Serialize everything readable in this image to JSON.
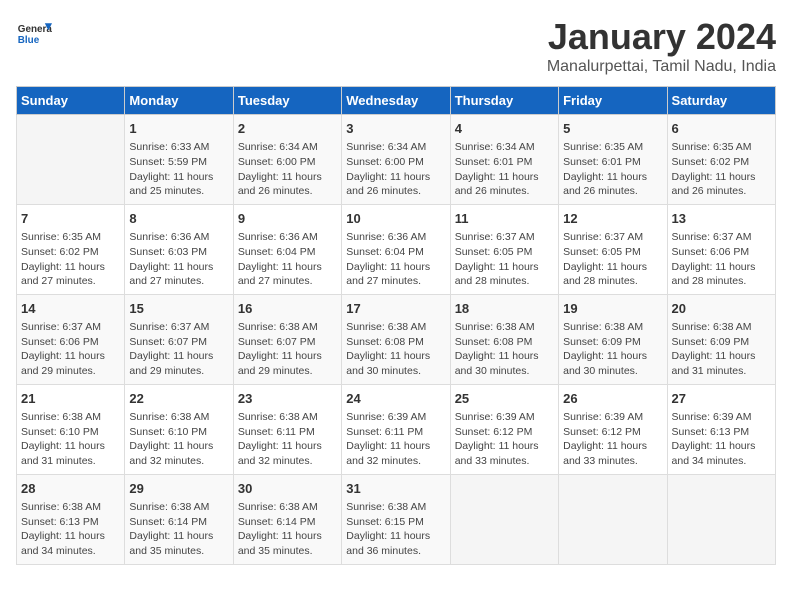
{
  "header": {
    "logo_general": "General",
    "logo_blue": "Blue",
    "title": "January 2024",
    "subtitle": "Manalurpettai, Tamil Nadu, India"
  },
  "calendar": {
    "days_of_week": [
      "Sunday",
      "Monday",
      "Tuesday",
      "Wednesday",
      "Thursday",
      "Friday",
      "Saturday"
    ],
    "weeks": [
      [
        {
          "day": "",
          "content": ""
        },
        {
          "day": "1",
          "content": "Sunrise: 6:33 AM\nSunset: 5:59 PM\nDaylight: 11 hours\nand 25 minutes."
        },
        {
          "day": "2",
          "content": "Sunrise: 6:34 AM\nSunset: 6:00 PM\nDaylight: 11 hours\nand 26 minutes."
        },
        {
          "day": "3",
          "content": "Sunrise: 6:34 AM\nSunset: 6:00 PM\nDaylight: 11 hours\nand 26 minutes."
        },
        {
          "day": "4",
          "content": "Sunrise: 6:34 AM\nSunset: 6:01 PM\nDaylight: 11 hours\nand 26 minutes."
        },
        {
          "day": "5",
          "content": "Sunrise: 6:35 AM\nSunset: 6:01 PM\nDaylight: 11 hours\nand 26 minutes."
        },
        {
          "day": "6",
          "content": "Sunrise: 6:35 AM\nSunset: 6:02 PM\nDaylight: 11 hours\nand 26 minutes."
        }
      ],
      [
        {
          "day": "7",
          "content": "Sunrise: 6:35 AM\nSunset: 6:02 PM\nDaylight: 11 hours\nand 27 minutes."
        },
        {
          "day": "8",
          "content": "Sunrise: 6:36 AM\nSunset: 6:03 PM\nDaylight: 11 hours\nand 27 minutes."
        },
        {
          "day": "9",
          "content": "Sunrise: 6:36 AM\nSunset: 6:04 PM\nDaylight: 11 hours\nand 27 minutes."
        },
        {
          "day": "10",
          "content": "Sunrise: 6:36 AM\nSunset: 6:04 PM\nDaylight: 11 hours\nand 27 minutes."
        },
        {
          "day": "11",
          "content": "Sunrise: 6:37 AM\nSunset: 6:05 PM\nDaylight: 11 hours\nand 28 minutes."
        },
        {
          "day": "12",
          "content": "Sunrise: 6:37 AM\nSunset: 6:05 PM\nDaylight: 11 hours\nand 28 minutes."
        },
        {
          "day": "13",
          "content": "Sunrise: 6:37 AM\nSunset: 6:06 PM\nDaylight: 11 hours\nand 28 minutes."
        }
      ],
      [
        {
          "day": "14",
          "content": "Sunrise: 6:37 AM\nSunset: 6:06 PM\nDaylight: 11 hours\nand 29 minutes."
        },
        {
          "day": "15",
          "content": "Sunrise: 6:37 AM\nSunset: 6:07 PM\nDaylight: 11 hours\nand 29 minutes."
        },
        {
          "day": "16",
          "content": "Sunrise: 6:38 AM\nSunset: 6:07 PM\nDaylight: 11 hours\nand 29 minutes."
        },
        {
          "day": "17",
          "content": "Sunrise: 6:38 AM\nSunset: 6:08 PM\nDaylight: 11 hours\nand 30 minutes."
        },
        {
          "day": "18",
          "content": "Sunrise: 6:38 AM\nSunset: 6:08 PM\nDaylight: 11 hours\nand 30 minutes."
        },
        {
          "day": "19",
          "content": "Sunrise: 6:38 AM\nSunset: 6:09 PM\nDaylight: 11 hours\nand 30 minutes."
        },
        {
          "day": "20",
          "content": "Sunrise: 6:38 AM\nSunset: 6:09 PM\nDaylight: 11 hours\nand 31 minutes."
        }
      ],
      [
        {
          "day": "21",
          "content": "Sunrise: 6:38 AM\nSunset: 6:10 PM\nDaylight: 11 hours\nand 31 minutes."
        },
        {
          "day": "22",
          "content": "Sunrise: 6:38 AM\nSunset: 6:10 PM\nDaylight: 11 hours\nand 32 minutes."
        },
        {
          "day": "23",
          "content": "Sunrise: 6:38 AM\nSunset: 6:11 PM\nDaylight: 11 hours\nand 32 minutes."
        },
        {
          "day": "24",
          "content": "Sunrise: 6:39 AM\nSunset: 6:11 PM\nDaylight: 11 hours\nand 32 minutes."
        },
        {
          "day": "25",
          "content": "Sunrise: 6:39 AM\nSunset: 6:12 PM\nDaylight: 11 hours\nand 33 minutes."
        },
        {
          "day": "26",
          "content": "Sunrise: 6:39 AM\nSunset: 6:12 PM\nDaylight: 11 hours\nand 33 minutes."
        },
        {
          "day": "27",
          "content": "Sunrise: 6:39 AM\nSunset: 6:13 PM\nDaylight: 11 hours\nand 34 minutes."
        }
      ],
      [
        {
          "day": "28",
          "content": "Sunrise: 6:38 AM\nSunset: 6:13 PM\nDaylight: 11 hours\nand 34 minutes."
        },
        {
          "day": "29",
          "content": "Sunrise: 6:38 AM\nSunset: 6:14 PM\nDaylight: 11 hours\nand 35 minutes."
        },
        {
          "day": "30",
          "content": "Sunrise: 6:38 AM\nSunset: 6:14 PM\nDaylight: 11 hours\nand 35 minutes."
        },
        {
          "day": "31",
          "content": "Sunrise: 6:38 AM\nSunset: 6:15 PM\nDaylight: 11 hours\nand 36 minutes."
        },
        {
          "day": "",
          "content": ""
        },
        {
          "day": "",
          "content": ""
        },
        {
          "day": "",
          "content": ""
        }
      ]
    ]
  }
}
